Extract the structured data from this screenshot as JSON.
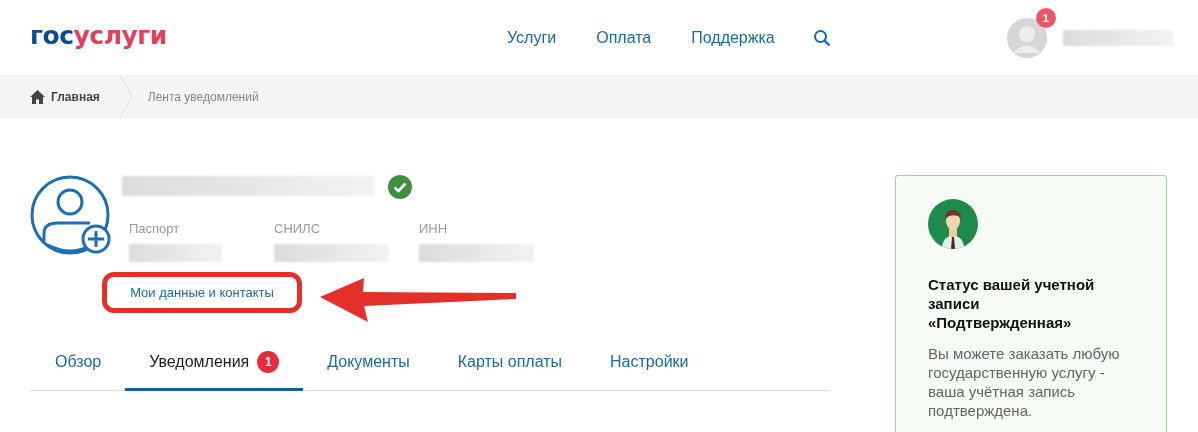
{
  "header": {
    "logo": {
      "prefix": "гос",
      "suffix": "услуги"
    },
    "nav": [
      "Услуги",
      "Оплата",
      "Поддержка"
    ],
    "user": {
      "badge": "1"
    }
  },
  "breadcrumbs": [
    {
      "label": "Главная",
      "kind": "home"
    },
    {
      "label": "Лента уведомлений",
      "kind": "current"
    }
  ],
  "profile": {
    "verified": true,
    "documents": [
      {
        "label": "Паспорт"
      },
      {
        "label": "СНИЛС"
      },
      {
        "label": "ИНН"
      }
    ],
    "link": "Мои данные и контакты",
    "highlighted": true
  },
  "tabs": [
    {
      "label": "Обзор",
      "selected": false
    },
    {
      "label": "Уведомления",
      "selected": true,
      "badge": "1"
    },
    {
      "label": "Документы",
      "selected": false
    },
    {
      "label": "Карты оплаты",
      "selected": false
    },
    {
      "label": "Настройки",
      "selected": false
    }
  ],
  "status_card": {
    "title": "Статус вашей учетной записи «Подтвержденная»",
    "text": "Вы можете заказать любую государственную услугу - ваша учётная запись подтверждена."
  }
}
